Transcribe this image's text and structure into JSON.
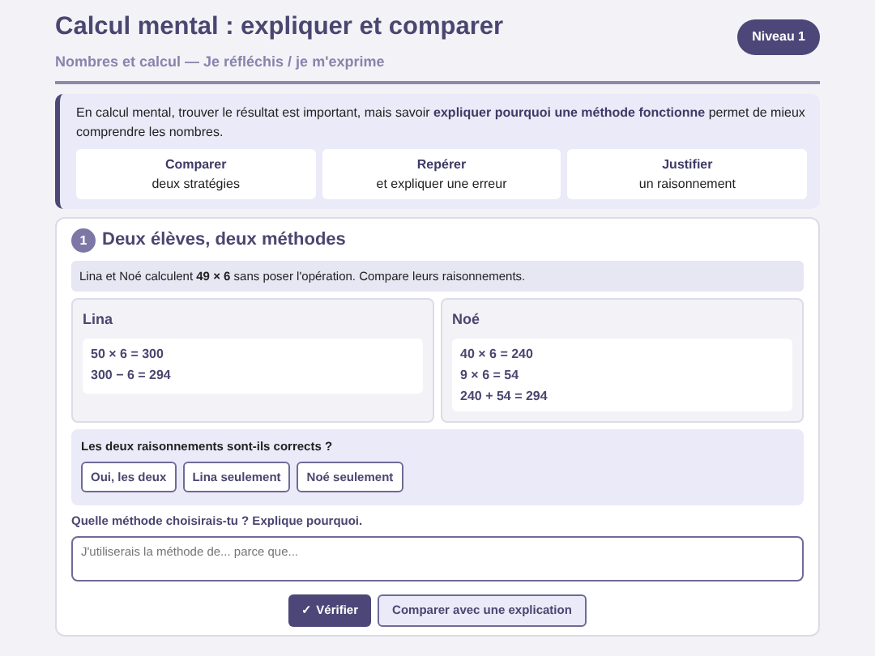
{
  "header": {
    "title": "Calcul mental : expliquer et comparer",
    "subtitle": "Nombres et calcul — Je réfléchis / je m'exprime",
    "level_badge": "Niveau 1"
  },
  "intro": {
    "text": "En calcul mental, trouver le résultat est important, mais savoir **expliquer pourquoi une méthode fonctionne** permet de mieux comprendre les nombres.",
    "goals": [
      {
        "title": "Comparer",
        "detail": "deux stratégies"
      },
      {
        "title": "Repérer",
        "detail": "et expliquer une erreur"
      },
      {
        "title": "Justifier",
        "detail": "un raisonnement"
      }
    ]
  },
  "exercise": {
    "number": "1",
    "title": "Deux élèves, deux méthodes",
    "instruction": "Lina et Noé calculent **49 × 6** sans poser l'opération. Compare leurs raisonnements.",
    "students": [
      {
        "name": "Lina",
        "steps": [
          "50 × 6 = 300",
          "300 − 6 = 294"
        ]
      },
      {
        "name": "Noé",
        "steps": [
          "40 × 6 = 240",
          "9 × 6 = 54",
          "240 + 54 = 294"
        ]
      }
    ],
    "question": "Les deux raisonnements sont-ils corrects ?",
    "choices": [
      {
        "label": "Oui, les deux",
        "selected": false
      },
      {
        "label": "Lina seulement",
        "selected": false
      },
      {
        "label": "Noé seulement",
        "selected": false
      }
    ],
    "explain_label": "Quelle méthode choisirais-tu ? Explique pourquoi.",
    "explain_placeholder": "J'utiliserais la méthode de... parce que...",
    "buttons": [
      {
        "label": "✓ Vérifier",
        "kind": "primary"
      },
      {
        "label": "Comparer avec une explication",
        "kind": "secondary"
      }
    ]
  }
}
